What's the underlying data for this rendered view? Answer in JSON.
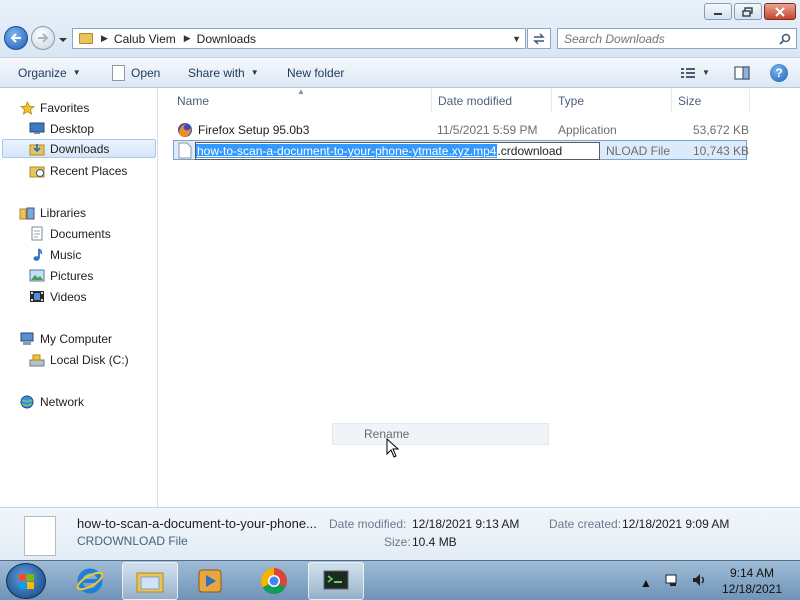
{
  "window": {
    "breadcrumb": [
      "Calub Viem",
      "Downloads"
    ],
    "search_placeholder": "Search Downloads"
  },
  "toolbar": {
    "organize": "Organize",
    "open": "Open",
    "share_with": "Share with",
    "new_folder": "New folder"
  },
  "sidebar": {
    "favorites": {
      "label": "Favorites",
      "items": [
        "Desktop",
        "Downloads",
        "Recent Places"
      ]
    },
    "libraries": {
      "label": "Libraries",
      "items": [
        "Documents",
        "Music",
        "Pictures",
        "Videos"
      ]
    },
    "computer": {
      "label": "My Computer",
      "items": [
        "Local Disk (C:)"
      ]
    },
    "network": "Network",
    "selected": "Downloads"
  },
  "columns": [
    "Name",
    "Date modified",
    "Type",
    "Size"
  ],
  "files": [
    {
      "name": "Firefox Setup 95.0b3",
      "date": "11/5/2021 5:59 PM",
      "type": "Application",
      "size": "53,672 KB"
    },
    {
      "name": "how-to-scan-a-document-to-your-phone-ytmate.xyz.mp4.crdownload",
      "type_visible": "NLOAD File",
      "size": "10,743 KB",
      "rename_selected": "how-to-scan-a-document-to-your-phone-ytmate.xyz.mp4",
      "rename_rest": ".crdownload"
    }
  ],
  "context_menu": {
    "rename": "Rename"
  },
  "details": {
    "name": "how-to-scan-a-document-to-your-phone...",
    "type": "CRDOWNLOAD File",
    "date_modified_label": "Date modified:",
    "date_modified": "12/18/2021 9:13 AM",
    "date_created_label": "Date created:",
    "date_created": "12/18/2021 9:09 AM",
    "size_label": "Size:",
    "size": "10.4 MB"
  },
  "taskbar": {
    "time": "9:14 AM",
    "date": "12/18/2021",
    "apps": [
      "internet-explorer",
      "windows-explorer",
      "media-player",
      "chrome",
      "terminal"
    ]
  }
}
